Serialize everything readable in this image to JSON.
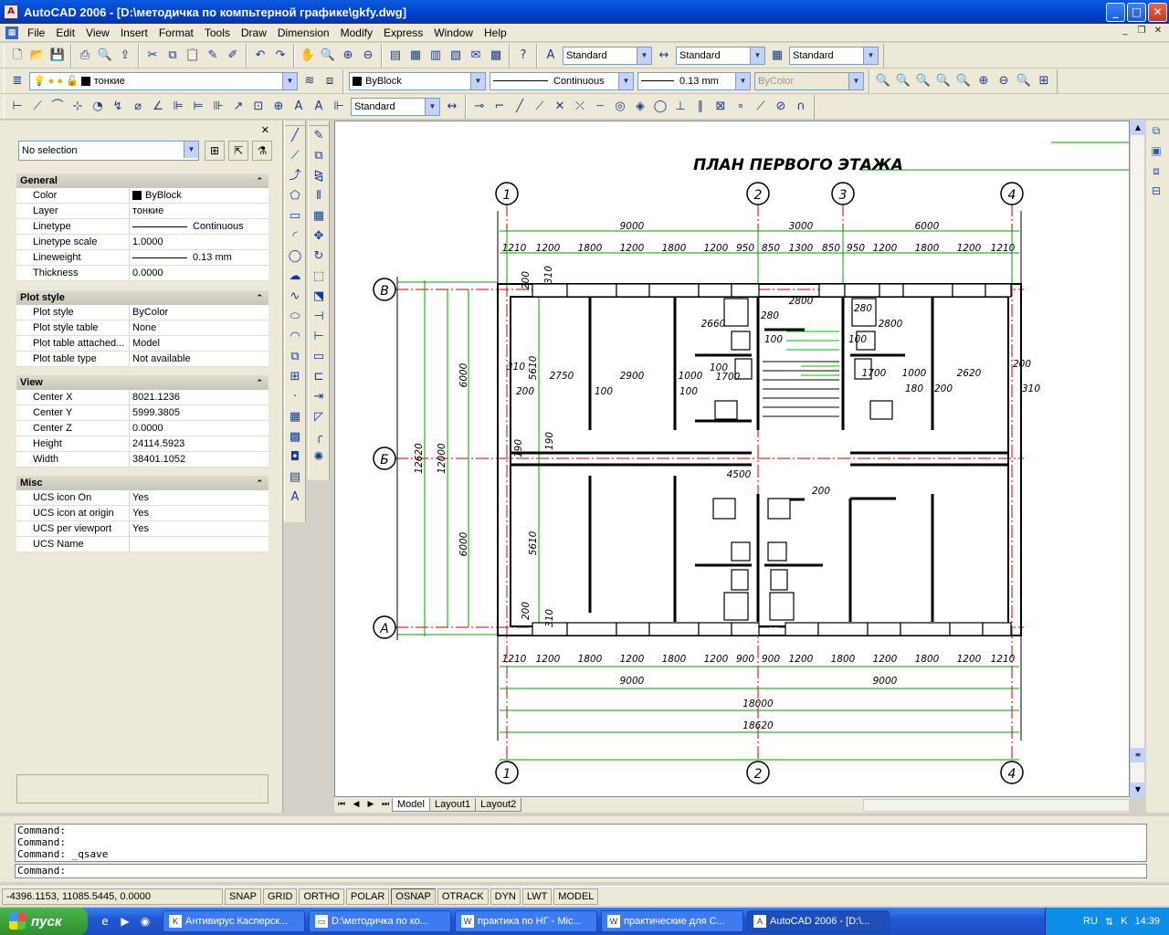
{
  "window": {
    "title": "AutoCAD 2006 - [D:\\методичка по компьтерной графике\\gkfy.dwg]",
    "app_icon": "autocad-icon"
  },
  "menu": [
    "File",
    "Edit",
    "View",
    "Insert",
    "Format",
    "Tools",
    "Draw",
    "Dimension",
    "Modify",
    "Express",
    "Window",
    "Help"
  ],
  "toolbars": {
    "text_style": "Standard",
    "dim_style": "Standard",
    "table_style": "Standard",
    "layer": "тонкие",
    "color": "ByBlock",
    "linetype": "Continuous",
    "lineweight": "0.13 mm",
    "plotstyle": "ByColor",
    "dim_style2": "Standard"
  },
  "properties": {
    "selection": "No selection",
    "sections": {
      "general": {
        "title": "General",
        "rows": [
          {
            "k": "Color",
            "v": "ByBlock"
          },
          {
            "k": "Layer",
            "v": "тонкие"
          },
          {
            "k": "Linetype",
            "v": "Continuous"
          },
          {
            "k": "Linetype scale",
            "v": "1.0000"
          },
          {
            "k": "Lineweight",
            "v": "0.13 mm"
          },
          {
            "k": "Thickness",
            "v": "0.0000"
          }
        ]
      },
      "plot": {
        "title": "Plot style",
        "rows": [
          {
            "k": "Plot style",
            "v": "ByColor"
          },
          {
            "k": "Plot style table",
            "v": "None"
          },
          {
            "k": "Plot table attached...",
            "v": "Model"
          },
          {
            "k": "Plot table type",
            "v": "Not available"
          }
        ]
      },
      "view": {
        "title": "View",
        "rows": [
          {
            "k": "Center X",
            "v": "8021.1236"
          },
          {
            "k": "Center Y",
            "v": "5999.3805"
          },
          {
            "k": "Center Z",
            "v": "0.0000"
          },
          {
            "k": "Height",
            "v": "24114.5923"
          },
          {
            "k": "Width",
            "v": "38401.1052"
          }
        ]
      },
      "misc": {
        "title": "Misc",
        "rows": [
          {
            "k": "UCS icon On",
            "v": "Yes"
          },
          {
            "k": "UCS icon at origin",
            "v": "Yes"
          },
          {
            "k": "UCS per viewport",
            "v": "Yes"
          },
          {
            "k": "UCS Name",
            "v": ""
          }
        ]
      }
    }
  },
  "drawing": {
    "title": "ПЛАН ПЕРВОГО ЭТАЖА",
    "axes_top": [
      "1",
      "2",
      "3",
      "4"
    ],
    "axes_bottom": [
      "1",
      "2",
      "4"
    ],
    "axes_left": [
      "В",
      "Б",
      "А"
    ],
    "dims_top_overall": [
      "9000",
      "3000",
      "6000"
    ],
    "dims_top_chain": [
      "1210",
      "1200",
      "1800",
      "1200",
      "1800",
      "1200",
      "950",
      "850",
      "1300",
      "850",
      "950",
      "1200",
      "1800",
      "1200",
      "1210"
    ],
    "dims_bottom_chain": [
      "1210",
      "1200",
      "1800",
      "1200",
      "1800",
      "1200",
      "900",
      "900",
      "1200",
      "1800",
      "1200",
      "1800",
      "1200",
      "1210"
    ],
    "dims_bottom_overall": [
      "9000",
      "9000"
    ],
    "dim_total_1": "18000",
    "dim_total_2": "18620",
    "dims_left": [
      "12620",
      "12000",
      "6000",
      "6000"
    ],
    "room_labels": [
      "2750",
      "2900",
      "2660",
      "2800",
      "2620",
      "4500",
      "5610",
      "5610",
      "1700",
      "1700",
      "1000",
      "1000",
      "280",
      "280",
      "200",
      "200",
      "310",
      "310",
      "100",
      "100",
      "100",
      "100",
      "100",
      "190",
      "190",
      "180",
      "200",
      "200",
      "310",
      "200",
      "310",
      "200",
      "2800"
    ]
  },
  "tabs": [
    "Model",
    "Layout1",
    "Layout2"
  ],
  "command": {
    "history": [
      "Command:",
      "Command:",
      "Command:  _qsave"
    ],
    "prompt": "Command:"
  },
  "status": {
    "coords": "-4396.1153, 11085.5445, 0.0000",
    "buttons": [
      "SNAP",
      "GRID",
      "ORTHO",
      "POLAR",
      "OSNAP",
      "OTRACK",
      "DYN",
      "LWT",
      "MODEL"
    ],
    "active": [
      "OSNAP"
    ]
  },
  "taskbar": {
    "start": "пуск",
    "tasks": [
      "Антивирус Касперск...",
      "D:\\методичка по ко...",
      "практика по НГ - Mic...",
      "практические для С...",
      "AutoCAD 2006 - [D:\\..."
    ],
    "lang": "RU",
    "time": "14:39"
  },
  "colors": {
    "titlebar": "#0a5ae0",
    "wall": "#000000",
    "axis": "#cc0000",
    "dimline": "#00a000"
  }
}
